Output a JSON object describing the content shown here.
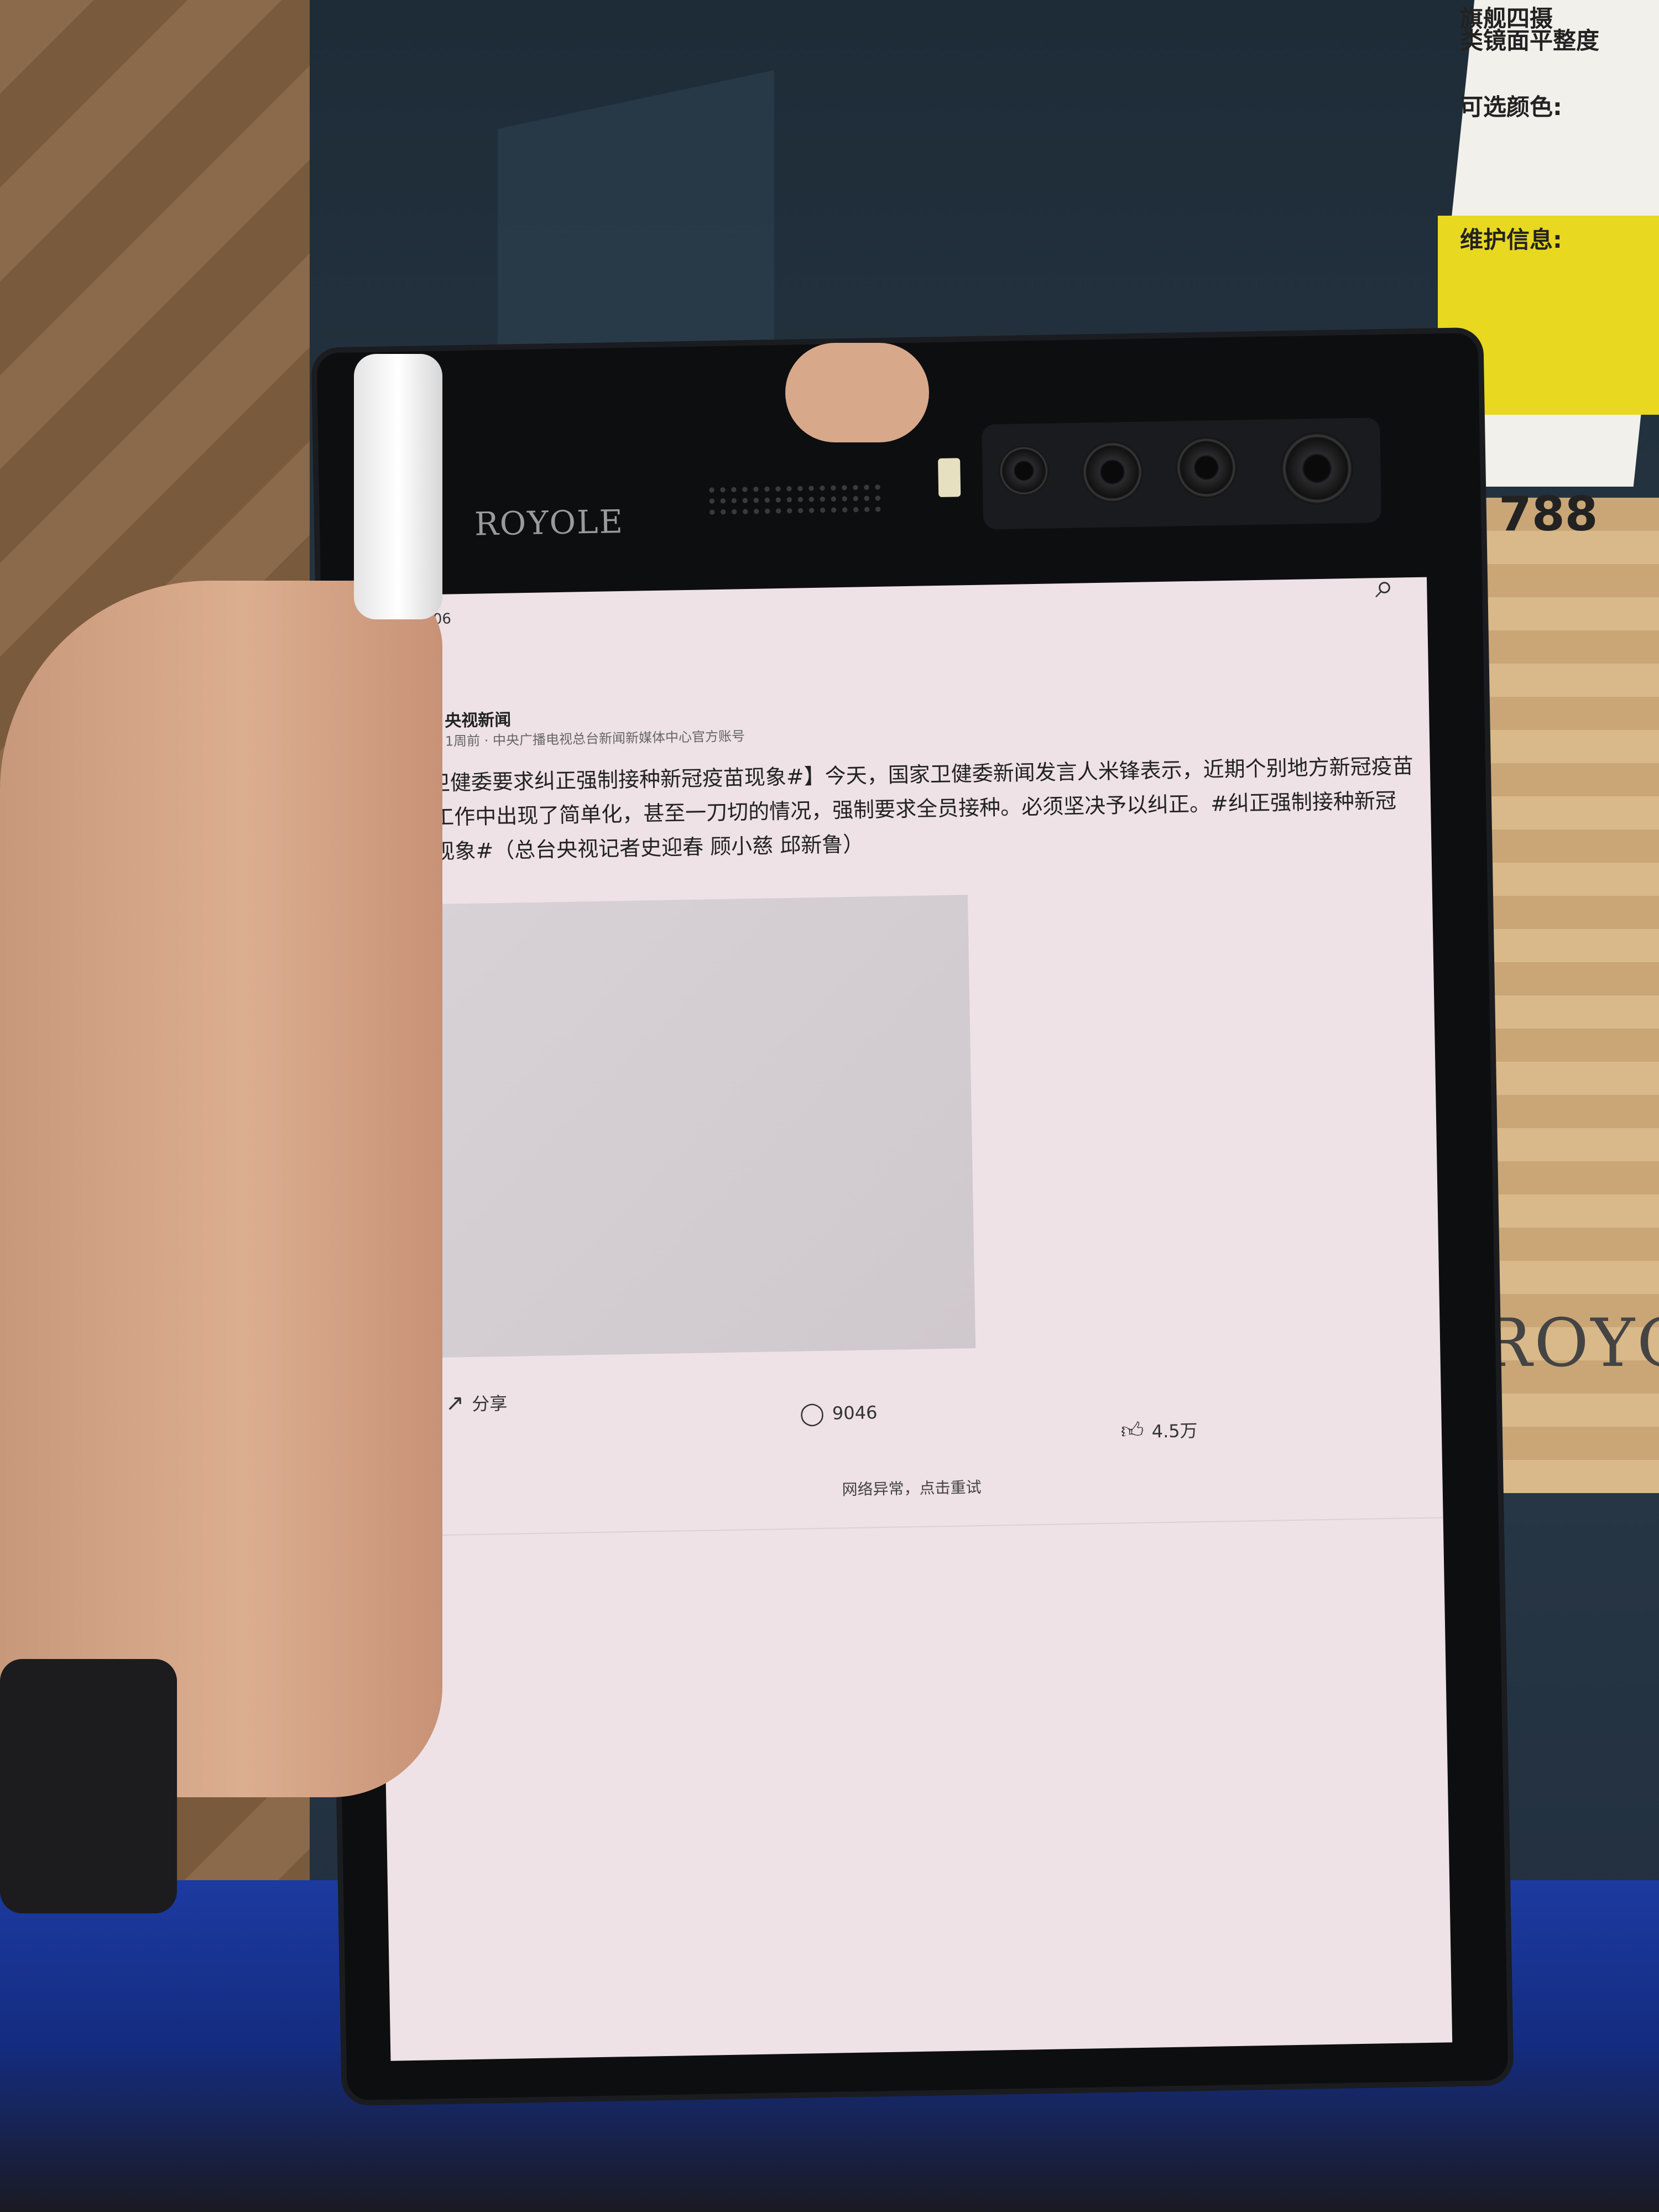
{
  "background": {
    "card_lines": [
      "旗舰四摄",
      "类镜面平整度",
      "可选颜色:",
      "维护信息:"
    ],
    "card_price": "788",
    "store_sign": "ROYOLE"
  },
  "device": {
    "brand": "ROYOLE"
  },
  "status_bar": {
    "time": "13:06",
    "battery_icon": "battery-icon",
    "search_icon": "search-icon"
  },
  "post": {
    "back_icon": "chevron-left-icon",
    "author": "央视新闻",
    "meta": "1周前 · 中央广播电视总台新闻新媒体中心官方账号",
    "body": "【#卫健委要求纠正强制接种新冠疫苗现象#】今天，国家卫健委新闻发言人米锋表示，近期个别地方新冠疫苗接种工作中出现了简单化，甚至一刀切的情况，强制要求全员接种。必须坚决予以纠正。#纠正强制接种新冠疫苗现象#（总台央视记者史迎春 顾小慈 邱新鲁）",
    "share_label": "分享",
    "comment_count": "9046",
    "like_count": "4.5万",
    "network_error": "网络异常，点击重试"
  },
  "colors": {
    "screen_bg": "#eee2e6",
    "bezel": "#0d0e10"
  }
}
